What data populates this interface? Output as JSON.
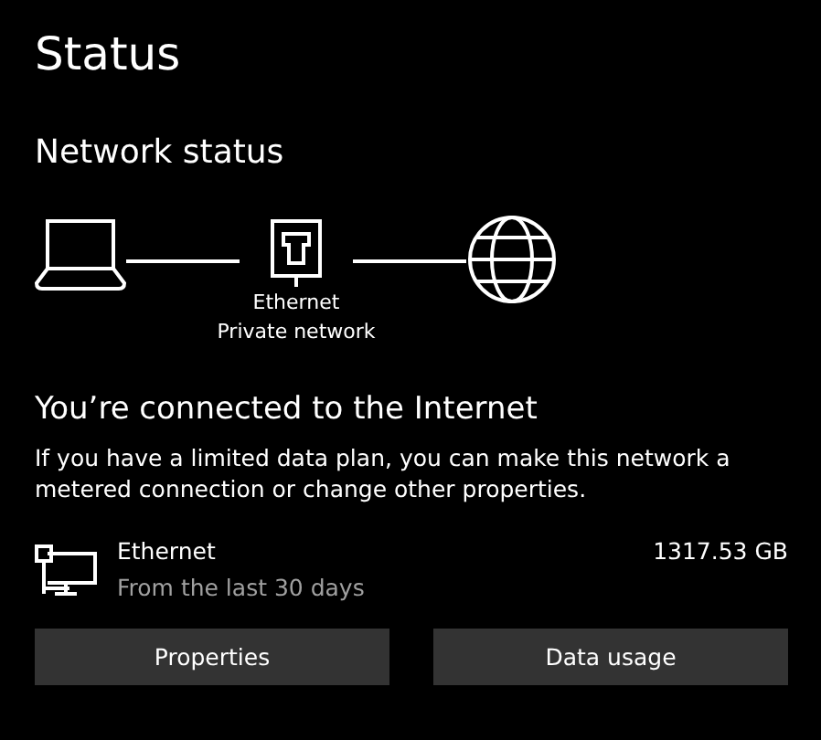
{
  "page": {
    "title": "Status"
  },
  "network_status": {
    "heading": "Network status",
    "adapter_name": "Ethernet",
    "network_type": "Private network"
  },
  "connection": {
    "heading": "You’re connected to the Internet",
    "description": "If you have a limited data plan, you can make this network a metered connection or change other properties."
  },
  "usage": {
    "name": "Ethernet",
    "period": "From the last 30 days",
    "amount": "1317.53 GB"
  },
  "buttons": [
    "Properties",
    "Data usage"
  ]
}
